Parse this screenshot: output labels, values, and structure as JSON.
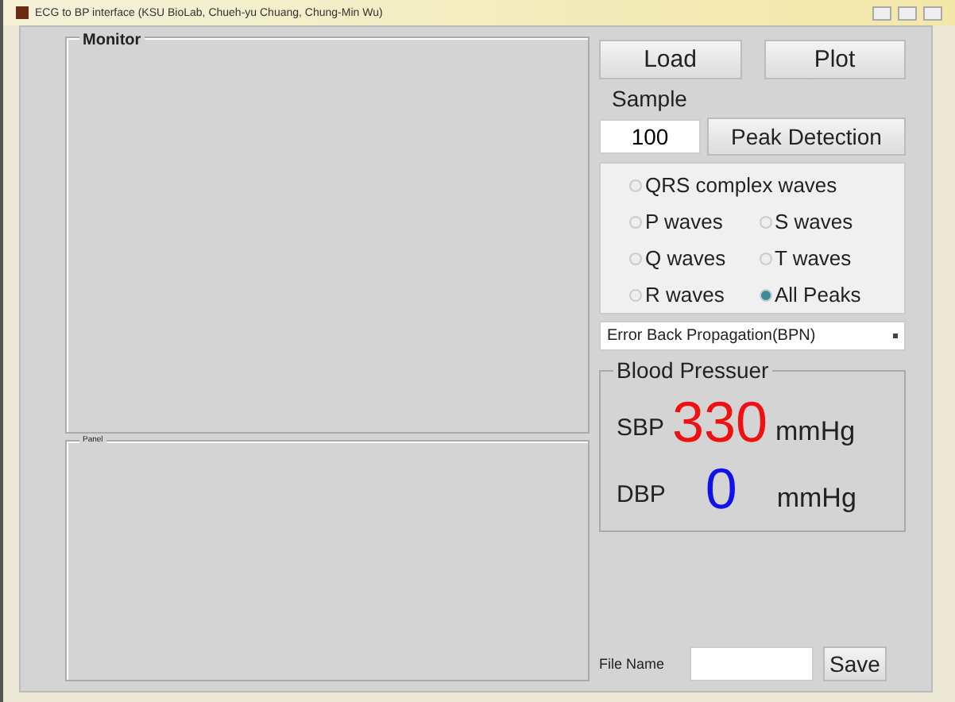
{
  "window": {
    "title": "ECG to BP interface (KSU BioLab,  Chueh-yu Chuang, Chung-Min Wu)"
  },
  "monitor": {
    "title": "Monitor"
  },
  "panel": {
    "title": "Panel"
  },
  "buttons": {
    "load": "Load",
    "plot": "Plot",
    "peak": "Peak Detection",
    "save": "Save"
  },
  "sample": {
    "label": "Sample",
    "value": "100"
  },
  "waves": [
    [
      {
        "label": "QRS complex waves",
        "selected": false
      }
    ],
    [
      {
        "label": "P waves",
        "selected": false
      },
      {
        "label": "S waves",
        "selected": false
      }
    ],
    [
      {
        "label": "Q waves",
        "selected": false
      },
      {
        "label": "T waves",
        "selected": false
      }
    ],
    [
      {
        "label": "R waves",
        "selected": false
      },
      {
        "label": "All Peaks",
        "selected": true
      }
    ]
  ],
  "method": {
    "value": "Error Back Propagation(BPN)"
  },
  "blood_pressure": {
    "title": "Blood Pressuer",
    "rows": [
      {
        "label": "SBP",
        "value": "330",
        "unit": "mmHg",
        "color": "#ee1111"
      },
      {
        "label": "DBP",
        "value": "0",
        "unit": "mmHg",
        "color": "#1111ee"
      }
    ]
  },
  "file_name": {
    "label": "File Name"
  }
}
